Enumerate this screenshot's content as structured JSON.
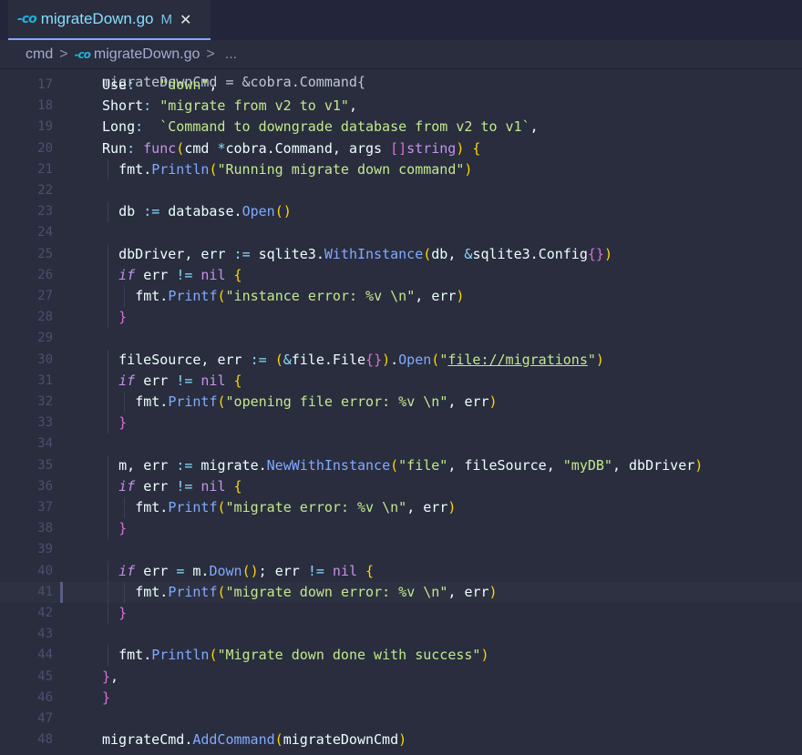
{
  "tab": {
    "icon": "go-icon",
    "icon_glyph": "-co",
    "filename": "migrateDown.go",
    "status": "M",
    "close": "✕"
  },
  "breadcrumb": {
    "folder": "cmd",
    "sep": ">",
    "icon_glyph": "-co",
    "file": "migrateDown.go",
    "more": "..."
  },
  "editor": {
    "partial_top_line": "migrateDownCmd = &cobra.Command{",
    "lines": [
      {
        "n": "17",
        "text": "Use:   \"down\","
      },
      {
        "n": "18",
        "text": "Short: \"migrate from v2 to v1\","
      },
      {
        "n": "19",
        "text": "Long:  `Command to downgrade database from v2 to v1`,"
      },
      {
        "n": "20",
        "text": "Run: func(cmd *cobra.Command, args []string) {"
      },
      {
        "n": "21",
        "text": "fmt.Println(\"Running migrate down command\")"
      },
      {
        "n": "22",
        "text": ""
      },
      {
        "n": "23",
        "text": "db := database.Open()"
      },
      {
        "n": "24",
        "text": ""
      },
      {
        "n": "25",
        "text": "dbDriver, err := sqlite3.WithInstance(db, &sqlite3.Config{})"
      },
      {
        "n": "26",
        "text": "if err != nil {"
      },
      {
        "n": "27",
        "text": "fmt.Printf(\"instance error: %v \\n\", err)"
      },
      {
        "n": "28",
        "text": "}"
      },
      {
        "n": "29",
        "text": ""
      },
      {
        "n": "30",
        "text": "fileSource, err := (&file.File{}).Open(\"file://migrations\")"
      },
      {
        "n": "31",
        "text": "if err != nil {"
      },
      {
        "n": "32",
        "text": "fmt.Printf(\"opening file error: %v \\n\", err)"
      },
      {
        "n": "33",
        "text": "}"
      },
      {
        "n": "34",
        "text": ""
      },
      {
        "n": "35",
        "text": "m, err := migrate.NewWithInstance(\"file\", fileSource, \"myDB\", dbDriver)"
      },
      {
        "n": "36",
        "text": "if err != nil {"
      },
      {
        "n": "37",
        "text": "fmt.Printf(\"migrate error: %v \\n\", err)"
      },
      {
        "n": "38",
        "text": "}"
      },
      {
        "n": "39",
        "text": ""
      },
      {
        "n": "40",
        "text": "if err = m.Down(); err != nil {"
      },
      {
        "n": "41",
        "text": "fmt.Printf(\"migrate down error: %v \\n\", err)"
      },
      {
        "n": "42",
        "text": "}"
      },
      {
        "n": "43",
        "text": ""
      },
      {
        "n": "44",
        "text": "fmt.Println(\"Migrate down done with success\")"
      },
      {
        "n": "45",
        "text": "},"
      },
      {
        "n": "46",
        "text": "}"
      },
      {
        "n": "47",
        "text": ""
      },
      {
        "n": "48",
        "text": "migrateCmd.AddCommand(migrateDownCmd)"
      }
    ]
  },
  "colors": {
    "background": "#292d3e",
    "keyword": "#c792ea",
    "function": "#82aaff",
    "string": "#c3e88d",
    "bracket": "#ffd700",
    "accent": "#89ddff"
  }
}
